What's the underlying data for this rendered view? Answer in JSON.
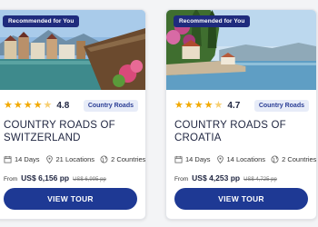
{
  "colors": {
    "brand_navy": "#1e3994",
    "badge_bg": "#1f2b7d",
    "star": "#f2a900",
    "tag_bg": "#e7ecf8",
    "tag_text": "#2b3e95"
  },
  "cards": [
    {
      "badge": "Recommended for You",
      "rating": "4.8",
      "rating_value": 4.8,
      "tag": "Country Roads",
      "title": "COUNTRY ROADS OF SWITZERLAND",
      "days": "14 Days",
      "locations": "21 Locations",
      "countries": "2 Countries",
      "from_label": "From",
      "price": "US$ 6,156 pp",
      "old_price": "US$ 6,995 pp",
      "button": "VIEW TOUR",
      "icons": [
        "calendar-icon",
        "location-pin-icon",
        "globe-icon"
      ]
    },
    {
      "badge": "Recommended for You",
      "rating": "4.7",
      "rating_value": 4.7,
      "tag": "Country Roads",
      "title": "COUNTRY ROADS OF CROATIA",
      "days": "14 Days",
      "locations": "14 Locations",
      "countries": "2 Countries",
      "from_label": "From",
      "price": "US$ 4,253 pp",
      "old_price": "US$ 4,725 pp",
      "button": "VIEW TOUR",
      "icons": [
        "calendar-icon",
        "location-pin-icon",
        "globe-icon"
      ]
    }
  ]
}
